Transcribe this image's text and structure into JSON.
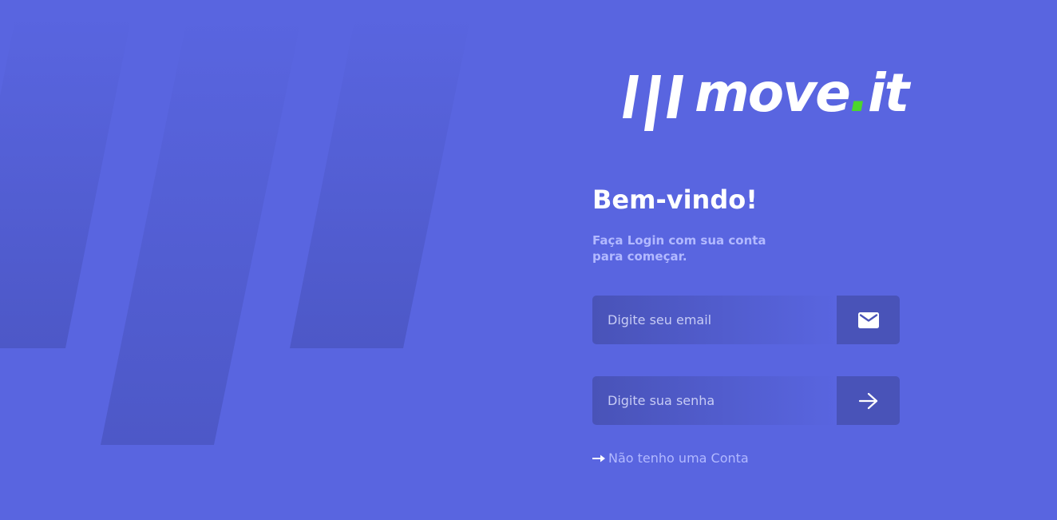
{
  "colors": {
    "background": "#5965E0",
    "input_background": "#4953B8",
    "accent_green": "#4CD62B",
    "text_white": "#FFFFFF",
    "text_muted": "#B2B9FF"
  },
  "logo": {
    "name": "move",
    "dot": ".",
    "suffix": "it"
  },
  "login": {
    "title": "Bem-vindo!",
    "subtitle": "Faça Login com sua conta para começar.",
    "email_placeholder": "Digite seu email",
    "email_icon": "envelope-icon",
    "password_placeholder": "Digite sua senha",
    "submit_icon": "arrow-right-icon",
    "signup_icon": "arrow-right-icon",
    "signup_label": "Não tenho uma Conta"
  }
}
